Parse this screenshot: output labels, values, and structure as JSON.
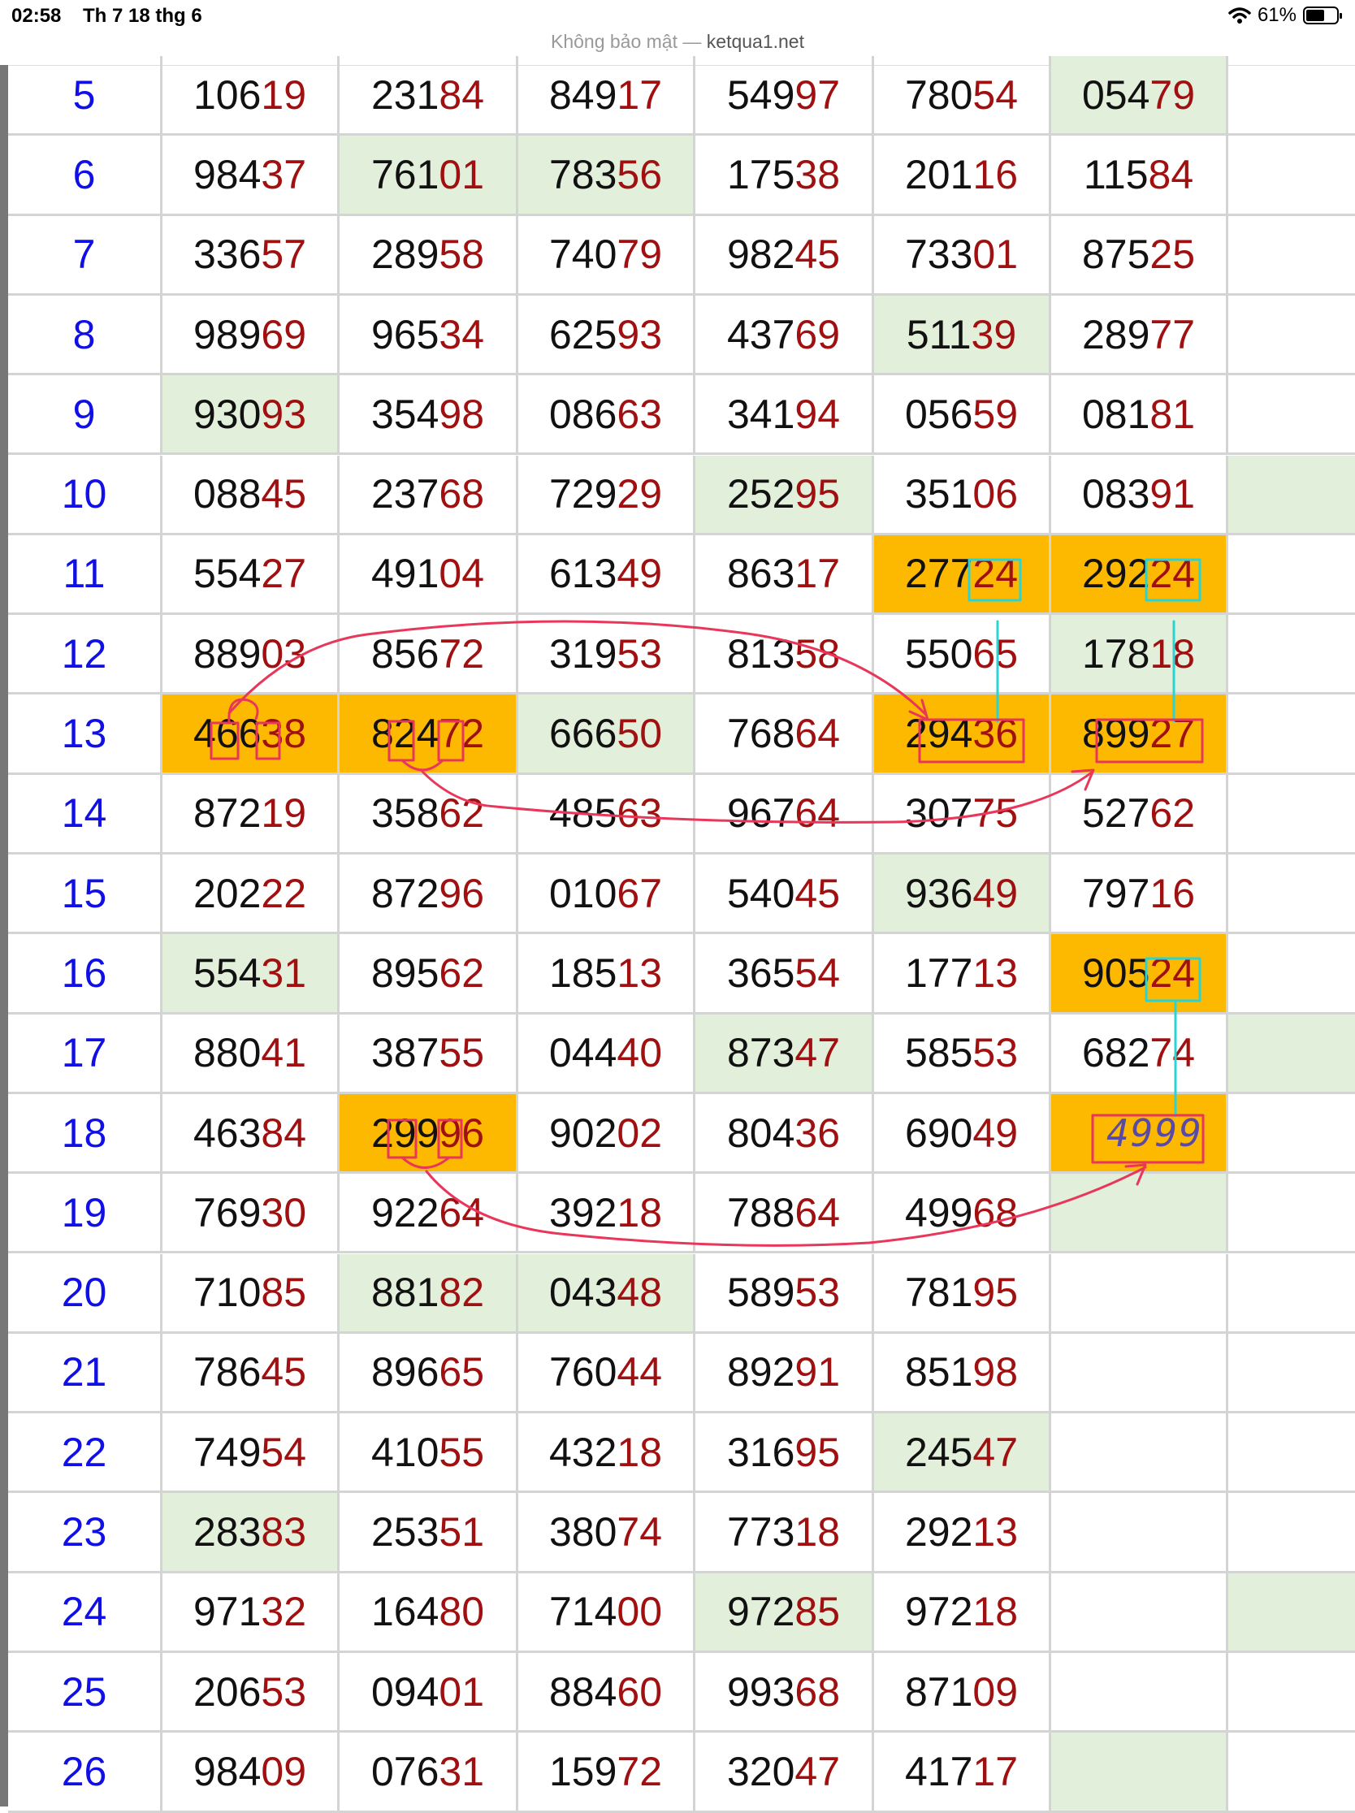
{
  "status_bar": {
    "time": "02:58",
    "date": "Th 7 18 thg 6",
    "security": "Không bảo mật",
    "separator": "—",
    "domain": "ketqua1.net",
    "battery": "61%",
    "battery_level": 0.61,
    "wifi_icon": "wifi-icon"
  },
  "colors": {
    "row_number": "#1010e6",
    "digits_head": "#111111",
    "digits_tail": "#a01010",
    "green_cell": "#e2efda",
    "orange_cell": "#fdb900",
    "annotation_red": "#e8375a",
    "annotation_cyan": "#2ad4d4"
  },
  "table": {
    "rows": [
      {
        "n": "5",
        "cells": [
          {
            "v": "10619"
          },
          {
            "v": "23184"
          },
          {
            "v": "84917"
          },
          {
            "v": "54997"
          },
          {
            "v": "78054"
          },
          {
            "v": "05479",
            "bg": "green"
          },
          {
            "v": ""
          }
        ]
      },
      {
        "n": "6",
        "cells": [
          {
            "v": "98437"
          },
          {
            "v": "76101",
            "bg": "green"
          },
          {
            "v": "78356",
            "bg": "green"
          },
          {
            "v": "17538"
          },
          {
            "v": "20116"
          },
          {
            "v": "11584"
          },
          {
            "v": ""
          }
        ]
      },
      {
        "n": "7",
        "cells": [
          {
            "v": "33657"
          },
          {
            "v": "28958"
          },
          {
            "v": "74079"
          },
          {
            "v": "98245"
          },
          {
            "v": "73301"
          },
          {
            "v": "87525"
          },
          {
            "v": ""
          }
        ]
      },
      {
        "n": "8",
        "cells": [
          {
            "v": "98969"
          },
          {
            "v": "96534"
          },
          {
            "v": "62593"
          },
          {
            "v": "43769"
          },
          {
            "v": "51139",
            "bg": "green"
          },
          {
            "v": "28977"
          },
          {
            "v": ""
          }
        ]
      },
      {
        "n": "9",
        "cells": [
          {
            "v": "93093",
            "bg": "green"
          },
          {
            "v": "35498"
          },
          {
            "v": "08663"
          },
          {
            "v": "34194"
          },
          {
            "v": "05659"
          },
          {
            "v": "08181"
          },
          {
            "v": ""
          }
        ]
      },
      {
        "n": "10",
        "cells": [
          {
            "v": "08845"
          },
          {
            "v": "23768"
          },
          {
            "v": "72929"
          },
          {
            "v": "25295",
            "bg": "green"
          },
          {
            "v": "35106"
          },
          {
            "v": "08391"
          },
          {
            "v": "",
            "bg": "green"
          }
        ]
      },
      {
        "n": "11",
        "cells": [
          {
            "v": "55427"
          },
          {
            "v": "49104"
          },
          {
            "v": "61349"
          },
          {
            "v": "86317"
          },
          {
            "v": "27724",
            "bg": "orange"
          },
          {
            "v": "29224",
            "bg": "orange"
          },
          {
            "v": ""
          }
        ]
      },
      {
        "n": "12",
        "cells": [
          {
            "v": "88903"
          },
          {
            "v": "85672"
          },
          {
            "v": "31953"
          },
          {
            "v": "81358"
          },
          {
            "v": "55065"
          },
          {
            "v": "17818",
            "bg": "green"
          },
          {
            "v": ""
          }
        ]
      },
      {
        "n": "13",
        "cells": [
          {
            "v": "46638",
            "bg": "orange"
          },
          {
            "v": "82472",
            "bg": "orange"
          },
          {
            "v": "66650",
            "bg": "green"
          },
          {
            "v": "76864"
          },
          {
            "v": "29436",
            "bg": "orange"
          },
          {
            "v": "89927",
            "bg": "orange"
          },
          {
            "v": ""
          }
        ]
      },
      {
        "n": "14",
        "cells": [
          {
            "v": "87219"
          },
          {
            "v": "35862"
          },
          {
            "v": "48563"
          },
          {
            "v": "96764"
          },
          {
            "v": "30775"
          },
          {
            "v": "52762"
          },
          {
            "v": ""
          }
        ]
      },
      {
        "n": "15",
        "cells": [
          {
            "v": "20222"
          },
          {
            "v": "87296"
          },
          {
            "v": "01067"
          },
          {
            "v": "54045"
          },
          {
            "v": "93649",
            "bg": "green"
          },
          {
            "v": "79716"
          },
          {
            "v": ""
          }
        ]
      },
      {
        "n": "16",
        "cells": [
          {
            "v": "55431",
            "bg": "green"
          },
          {
            "v": "89562"
          },
          {
            "v": "18513"
          },
          {
            "v": "36554"
          },
          {
            "v": "17713"
          },
          {
            "v": "90524",
            "bg": "orange"
          },
          {
            "v": ""
          }
        ]
      },
      {
        "n": "17",
        "cells": [
          {
            "v": "88041"
          },
          {
            "v": "38755"
          },
          {
            "v": "04440"
          },
          {
            "v": "87347",
            "bg": "green"
          },
          {
            "v": "58553"
          },
          {
            "v": "68274"
          },
          {
            "v": "",
            "bg": "green"
          }
        ]
      },
      {
        "n": "18",
        "cells": [
          {
            "v": "46384"
          },
          {
            "v": "29996",
            "bg": "orange"
          },
          {
            "v": "90202"
          },
          {
            "v": "80436"
          },
          {
            "v": "69049"
          },
          {
            "v": "",
            "bg": "orange",
            "handwritten": "4999"
          },
          {
            "v": ""
          }
        ]
      },
      {
        "n": "19",
        "cells": [
          {
            "v": "76930"
          },
          {
            "v": "92264"
          },
          {
            "v": "39218"
          },
          {
            "v": "78864"
          },
          {
            "v": "49968"
          },
          {
            "v": "",
            "bg": "green"
          },
          {
            "v": ""
          }
        ]
      },
      {
        "n": "20",
        "cells": [
          {
            "v": "71085"
          },
          {
            "v": "88182",
            "bg": "green"
          },
          {
            "v": "04348",
            "bg": "green"
          },
          {
            "v": "58953"
          },
          {
            "v": "78195"
          },
          {
            "v": ""
          },
          {
            "v": ""
          }
        ]
      },
      {
        "n": "21",
        "cells": [
          {
            "v": "78645"
          },
          {
            "v": "89665"
          },
          {
            "v": "76044"
          },
          {
            "v": "89291"
          },
          {
            "v": "85198"
          },
          {
            "v": ""
          },
          {
            "v": ""
          }
        ]
      },
      {
        "n": "22",
        "cells": [
          {
            "v": "74954"
          },
          {
            "v": "41055"
          },
          {
            "v": "43218"
          },
          {
            "v": "31695"
          },
          {
            "v": "24547",
            "bg": "green"
          },
          {
            "v": ""
          },
          {
            "v": ""
          }
        ]
      },
      {
        "n": "23",
        "cells": [
          {
            "v": "28383",
            "bg": "green"
          },
          {
            "v": "25351"
          },
          {
            "v": "38074"
          },
          {
            "v": "77318"
          },
          {
            "v": "29213"
          },
          {
            "v": ""
          },
          {
            "v": ""
          }
        ]
      },
      {
        "n": "24",
        "cells": [
          {
            "v": "97132"
          },
          {
            "v": "16480"
          },
          {
            "v": "71400"
          },
          {
            "v": "97285",
            "bg": "green"
          },
          {
            "v": "97218"
          },
          {
            "v": ""
          },
          {
            "v": "",
            "bg": "green"
          }
        ]
      },
      {
        "n": "25",
        "cells": [
          {
            "v": "20653"
          },
          {
            "v": "09401"
          },
          {
            "v": "88460"
          },
          {
            "v": "99368"
          },
          {
            "v": "87109"
          },
          {
            "v": ""
          },
          {
            "v": ""
          }
        ]
      },
      {
        "n": "26",
        "cells": [
          {
            "v": "98409"
          },
          {
            "v": "07631"
          },
          {
            "v": "15972"
          },
          {
            "v": "32047"
          },
          {
            "v": "41717"
          },
          {
            "v": "",
            "bg": "green"
          },
          {
            "v": ""
          }
        ]
      }
    ]
  }
}
